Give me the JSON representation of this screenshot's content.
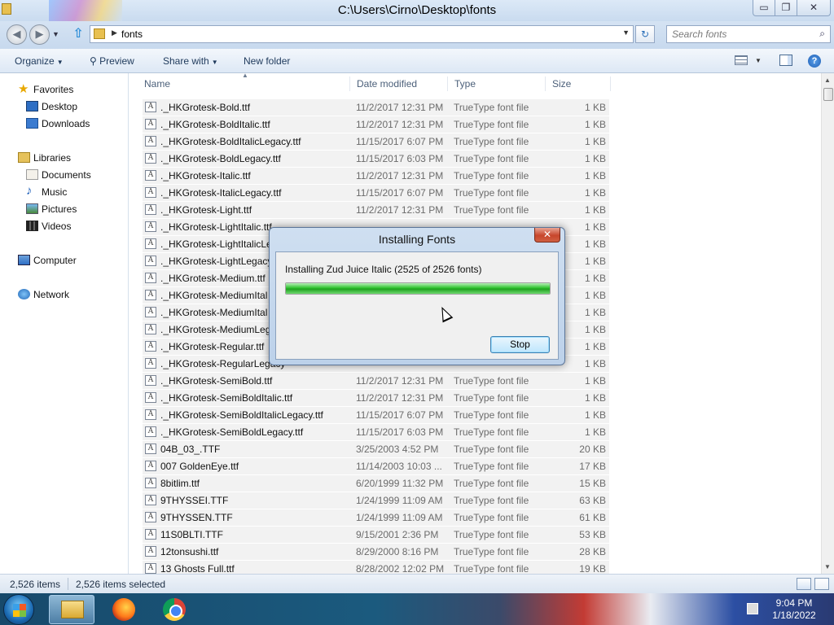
{
  "window": {
    "title": "C:\\Users\\Cirno\\Desktop\\fonts",
    "minimize_glyph": "▭",
    "maximize_glyph": "❐",
    "close_glyph": "✕"
  },
  "navbar": {
    "path": "fonts",
    "search_placeholder": "Search fonts",
    "back_glyph": "◀",
    "forward_glyph": "▶",
    "up_glyph": "⇧",
    "refresh_glyph": "↻",
    "search_glyph": "⌕"
  },
  "toolbar": {
    "organize": "Organize",
    "preview": "Preview",
    "share_with": "Share with",
    "new_folder": "New folder",
    "help_glyph": "?"
  },
  "sidebar": {
    "items": [
      {
        "label": "Favorites",
        "icon": "star-icon",
        "level": "top"
      },
      {
        "label": "Desktop",
        "icon": "desktop-icon",
        "level": "sub"
      },
      {
        "label": "Downloads",
        "icon": "downloads-icon",
        "level": "sub"
      },
      {
        "label": "Libraries",
        "icon": "libraries-icon",
        "level": "top"
      },
      {
        "label": "Documents",
        "icon": "documents-icon",
        "level": "sub"
      },
      {
        "label": "Music",
        "icon": "music-icon",
        "level": "sub"
      },
      {
        "label": "Pictures",
        "icon": "pictures-icon",
        "level": "sub"
      },
      {
        "label": "Videos",
        "icon": "videos-icon",
        "level": "sub"
      },
      {
        "label": "Computer",
        "icon": "computer-icon",
        "level": "top"
      },
      {
        "label": "Network",
        "icon": "network-icon",
        "level": "top"
      }
    ]
  },
  "columns": {
    "name": "Name",
    "date_modified": "Date modified",
    "type": "Type",
    "size": "Size"
  },
  "files": [
    {
      "name": "._HKGrotesk-Bold.ttf",
      "date": "11/2/2017 12:31 PM",
      "type": "TrueType font file",
      "size": "1 KB"
    },
    {
      "name": "._HKGrotesk-BoldItalic.ttf",
      "date": "11/2/2017 12:31 PM",
      "type": "TrueType font file",
      "size": "1 KB"
    },
    {
      "name": "._HKGrotesk-BoldItalicLegacy.ttf",
      "date": "11/15/2017 6:07 PM",
      "type": "TrueType font file",
      "size": "1 KB"
    },
    {
      "name": "._HKGrotesk-BoldLegacy.ttf",
      "date": "11/15/2017 6:03 PM",
      "type": "TrueType font file",
      "size": "1 KB"
    },
    {
      "name": "._HKGrotesk-Italic.ttf",
      "date": "11/2/2017 12:31 PM",
      "type": "TrueType font file",
      "size": "1 KB"
    },
    {
      "name": "._HKGrotesk-ItalicLegacy.ttf",
      "date": "11/15/2017 6:07 PM",
      "type": "TrueType font file",
      "size": "1 KB"
    },
    {
      "name": "._HKGrotesk-Light.ttf",
      "date": "11/2/2017 12:31 PM",
      "type": "TrueType font file",
      "size": "1 KB"
    },
    {
      "name": "._HKGrotesk-LightItalic.ttf",
      "date": "",
      "type": "",
      "size": "1 KB"
    },
    {
      "name": "._HKGrotesk-LightItalicLe",
      "date": "",
      "type": "",
      "size": "1 KB"
    },
    {
      "name": "._HKGrotesk-LightLegacy",
      "date": "",
      "type": "",
      "size": "1 KB"
    },
    {
      "name": "._HKGrotesk-Medium.ttf",
      "date": "",
      "type": "",
      "size": "1 KB"
    },
    {
      "name": "._HKGrotesk-MediumItal",
      "date": "",
      "type": "",
      "size": "1 KB"
    },
    {
      "name": "._HKGrotesk-MediumItal",
      "date": "",
      "type": "",
      "size": "1 KB"
    },
    {
      "name": "._HKGrotesk-MediumLeg",
      "date": "",
      "type": "",
      "size": "1 KB"
    },
    {
      "name": "._HKGrotesk-Regular.ttf",
      "date": "",
      "type": "",
      "size": "1 KB"
    },
    {
      "name": "._HKGrotesk-RegularLegacy",
      "date": "",
      "type": "",
      "size": "1 KB"
    },
    {
      "name": "._HKGrotesk-SemiBold.ttf",
      "date": "11/2/2017 12:31 PM",
      "type": "TrueType font file",
      "size": "1 KB"
    },
    {
      "name": "._HKGrotesk-SemiBoldItalic.ttf",
      "date": "11/2/2017 12:31 PM",
      "type": "TrueType font file",
      "size": "1 KB"
    },
    {
      "name": "._HKGrotesk-SemiBoldItalicLegacy.ttf",
      "date": "11/15/2017 6:07 PM",
      "type": "TrueType font file",
      "size": "1 KB"
    },
    {
      "name": "._HKGrotesk-SemiBoldLegacy.ttf",
      "date": "11/15/2017 6:03 PM",
      "type": "TrueType font file",
      "size": "1 KB"
    },
    {
      "name": "04B_03_.TTF",
      "date": "3/25/2003 4:52 PM",
      "type": "TrueType font file",
      "size": "20 KB"
    },
    {
      "name": "007 GoldenEye.ttf",
      "date": "11/14/2003 10:03 ...",
      "type": "TrueType font file",
      "size": "17 KB"
    },
    {
      "name": "8bitlim.ttf",
      "date": "6/20/1999 11:32 PM",
      "type": "TrueType font file",
      "size": "15 KB"
    },
    {
      "name": "9THYSSEI.TTF",
      "date": "1/24/1999 11:09 AM",
      "type": "TrueType font file",
      "size": "63 KB"
    },
    {
      "name": "9THYSSEN.TTF",
      "date": "1/24/1999 11:09 AM",
      "type": "TrueType font file",
      "size": "61 KB"
    },
    {
      "name": "11S0BLTI.TTF",
      "date": "9/15/2001 2:36 PM",
      "type": "TrueType font file",
      "size": "53 KB"
    },
    {
      "name": "12tonsushi.ttf",
      "date": "8/29/2000 8:16 PM",
      "type": "TrueType font file",
      "size": "28 KB"
    },
    {
      "name": "13 Ghosts Full.ttf",
      "date": "8/28/2002 12:02 PM",
      "type": "TrueType font file",
      "size": "19 KB"
    }
  ],
  "file_icon_glyph": "A",
  "status": {
    "item_count": "2,526 items",
    "selected_count": "2,526 items selected"
  },
  "dialog": {
    "title": "Installing Fonts",
    "message": "Installing Zud Juice Italic (2525 of 2526 fonts)",
    "progress_fraction": 0.9996,
    "stop_label": "Stop",
    "close_glyph": "✕"
  },
  "taskbar": {
    "time": "9:04 PM",
    "date": "1/18/2022",
    "apps": [
      "explorer-icon",
      "firefox-icon",
      "chrome-icon"
    ]
  }
}
